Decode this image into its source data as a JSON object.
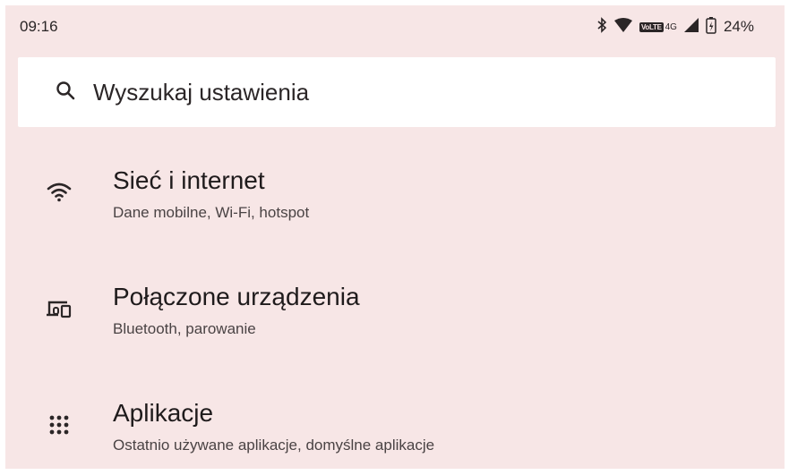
{
  "status_bar": {
    "time": "09:16",
    "network_badge": "VoLTE",
    "network_type": "4G",
    "battery_percent": "24%",
    "icons": [
      "bluetooth-icon",
      "wifi-icon",
      "signal-icon",
      "battery-icon"
    ]
  },
  "search": {
    "placeholder": "Wyszukaj ustawienia"
  },
  "settings": [
    {
      "icon": "wifi-icon",
      "title": "Sieć i internet",
      "subtitle": "Dane mobilne, Wi-Fi, hotspot"
    },
    {
      "icon": "connected-devices-icon",
      "title": "Połączone urządzenia",
      "subtitle": "Bluetooth, parowanie"
    },
    {
      "icon": "apps-grid-icon",
      "title": "Aplikacje",
      "subtitle": "Ostatnio używane aplikacje, domyślne aplikacje"
    }
  ],
  "colors": {
    "background": "#f7e6e6",
    "search_bg": "#ffffff",
    "text": "#1f1b1c"
  }
}
